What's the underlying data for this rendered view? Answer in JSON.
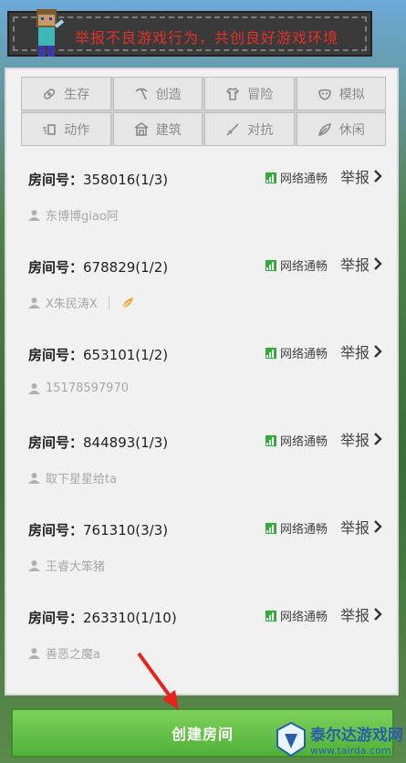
{
  "banner": {
    "text": "举报不良游戏行为，共创良好游戏环境"
  },
  "categories": [
    {
      "label": "生存",
      "icon": "bandage-icon"
    },
    {
      "label": "创造",
      "icon": "pickaxe-icon"
    },
    {
      "label": "冒险",
      "icon": "shirt-icon"
    },
    {
      "label": "模拟",
      "icon": "mask-icon"
    },
    {
      "label": "动作",
      "icon": "speed-icon"
    },
    {
      "label": "建筑",
      "icon": "building-icon"
    },
    {
      "label": "对抗",
      "icon": "sword-icon"
    },
    {
      "label": "休闲",
      "icon": "leaf-icon"
    }
  ],
  "room_label": "房间号：",
  "network_label": "网络通畅",
  "report_label": "举报",
  "rooms": [
    {
      "number": "358016(1/3)",
      "owner": "东博博giao阿"
    },
    {
      "number": "678829(1/2)",
      "owner": "X朱民涛X"
    },
    {
      "number": "653101(1/2)",
      "owner": "15178597970"
    },
    {
      "number": "844893(1/3)",
      "owner": "取下星星给ta"
    },
    {
      "number": "761310(3/3)",
      "owner": "王睿大笨猪"
    },
    {
      "number": "263310(1/10)",
      "owner": "善恶之魔a"
    }
  ],
  "create_button": "创建房间",
  "watermark": {
    "title": "泰尔达游戏网",
    "url": "www.tairda.com"
  },
  "colors": {
    "accent_green": "#4fb13a",
    "banner_text": "#e0322c",
    "signal": "#2fae38"
  }
}
